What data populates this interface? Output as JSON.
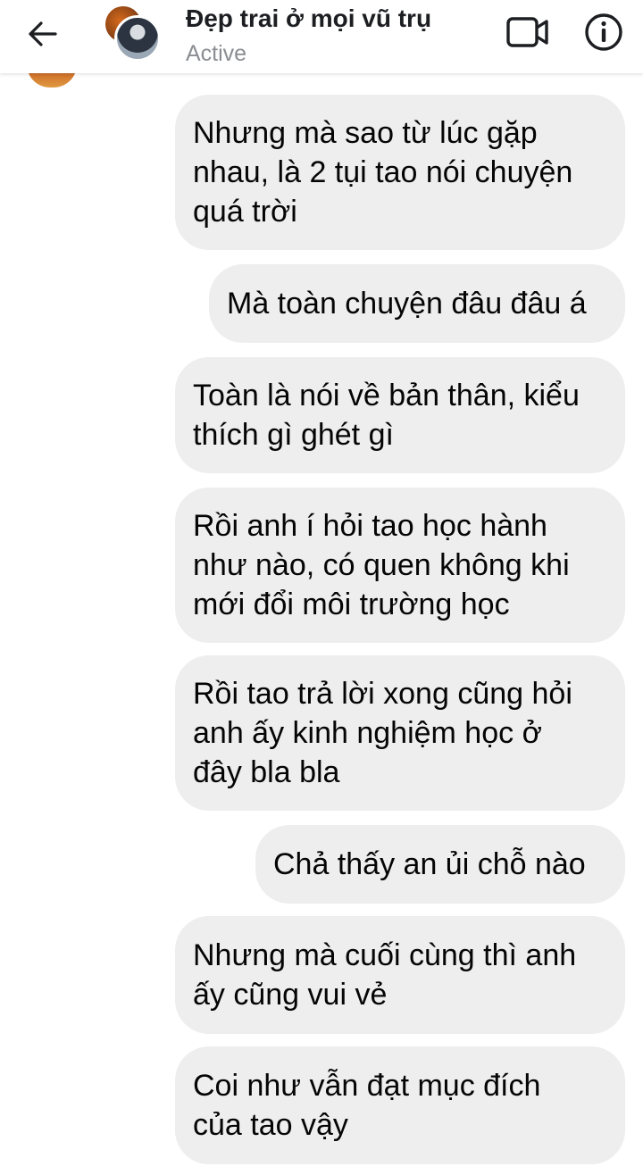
{
  "header": {
    "back_icon": "arrow-left-icon",
    "contact_name": "Đẹp trai ở mọi vũ trụ",
    "status": "Active",
    "video_icon": "video-camera-icon",
    "info_icon": "info-icon"
  },
  "messages": [
    {
      "text": "Nhưng mà sao từ lúc gặp\nnhau, là 2 tụi tao nói chuyện\nquá trời"
    },
    {
      "text": "Mà toàn chuyện đâu đâu á"
    },
    {
      "text": "Toàn là nói về bản thân, kiểu\nthích gì ghét gì"
    },
    {
      "text": "Rồi anh í hỏi tao học hành\nnhư nào, có quen không khi\nmới đổi môi trường học"
    },
    {
      "text": "Rồi tao trả lời xong cũng hỏi\nanh ấy kinh nghiệm học ở\nđây bla bla"
    },
    {
      "text": "Chả thấy an ủi chỗ nào"
    },
    {
      "text": "Nhưng mà cuối cùng thì anh\nấy cũng vui vẻ"
    },
    {
      "text": "Coi như vẫn đạt mục đích\ncủa tao vậy"
    }
  ]
}
